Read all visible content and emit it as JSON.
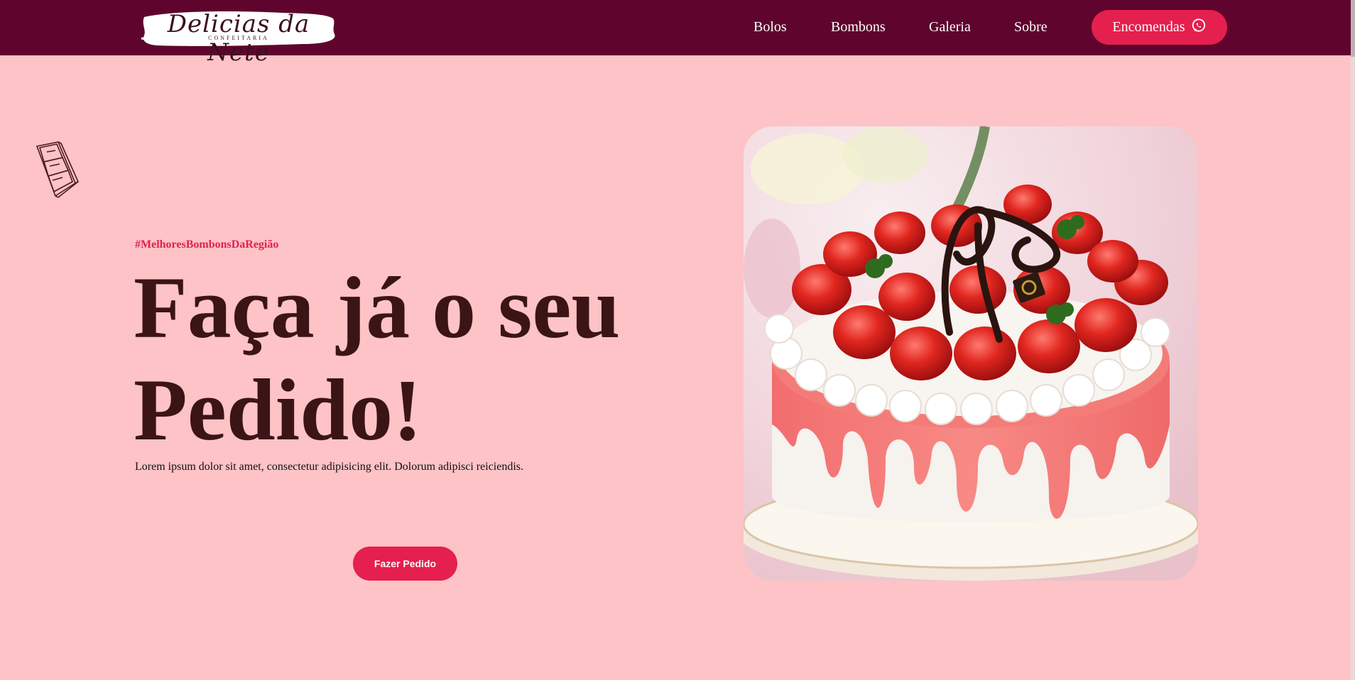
{
  "header": {
    "logo_text": "Delicias da Nete",
    "logo_subtext": "CONFEITARIA",
    "nav": [
      {
        "label": "Bolos"
      },
      {
        "label": "Bombons"
      },
      {
        "label": "Galeria"
      },
      {
        "label": "Sobre"
      }
    ],
    "cta_label": "Encomendas",
    "cta_icon": "whatsapp-icon"
  },
  "hero": {
    "hashtag": "#MelhoresBombonsDaRegião",
    "headline_line1": "Faça já o seu",
    "headline_line2": "Pedido!",
    "description": "Lorem ipsum dolor sit amet, consectetur adipisicing elit. Dolorum adipisci reiciendis.",
    "button_label": "Fazer Pedido",
    "image": "strawberry-cake-image",
    "decoration": "chocolate-bar-sketch-icon"
  },
  "colors": {
    "background": "#fdc3c7",
    "topbar": "#5f052d",
    "accent": "#e51f4e",
    "headline": "#3b1416"
  }
}
